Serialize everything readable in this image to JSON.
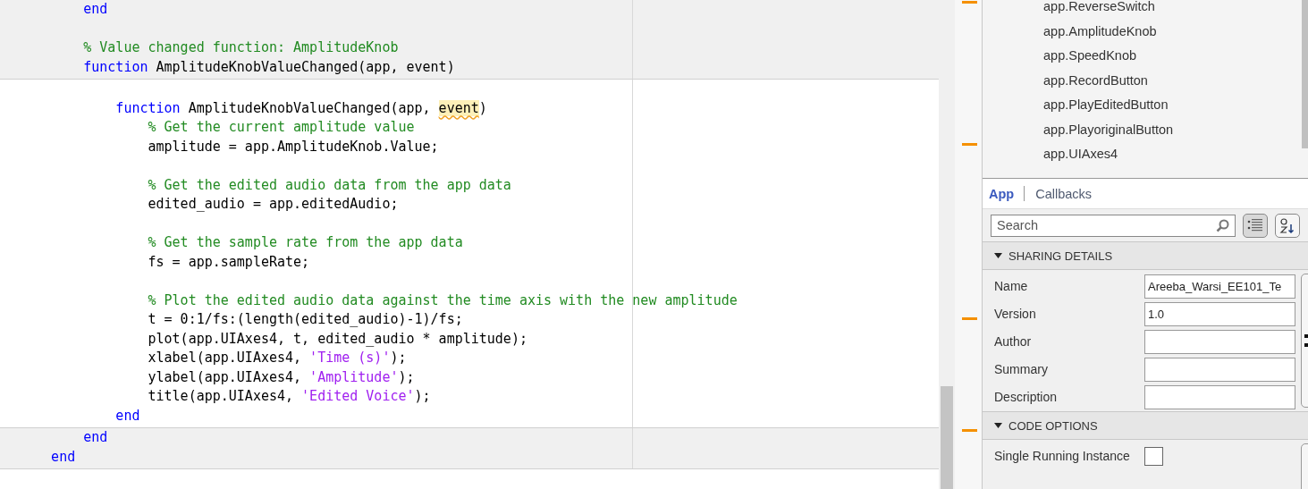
{
  "editor": {
    "blocks": [
      {
        "editable": false,
        "lines": [
          {
            "kind": "code",
            "segments": [
              {
                "kind": "keyword",
                "text": "        end"
              }
            ]
          },
          {
            "kind": "blank"
          },
          {
            "kind": "code",
            "segments": [
              {
                "kind": "comment",
                "text": "        % Value changed function: AmplitudeKnob"
              }
            ]
          },
          {
            "kind": "code",
            "segments": [
              {
                "kind": "keyword",
                "text": "        function"
              },
              {
                "kind": "plain",
                "text": " AmplitudeKnobValueChanged(app, event)"
              }
            ]
          }
        ]
      },
      {
        "editable": true,
        "lines": [
          {
            "kind": "blank"
          },
          {
            "kind": "code",
            "segments": [
              {
                "kind": "keyword",
                "text": "            function"
              },
              {
                "kind": "plain",
                "text": " AmplitudeKnobValueChanged(app, "
              },
              {
                "kind": "warning",
                "text": "event"
              },
              {
                "kind": "plain",
                "text": ")"
              }
            ]
          },
          {
            "kind": "code",
            "segments": [
              {
                "kind": "comment",
                "text": "                % Get the current amplitude value"
              }
            ]
          },
          {
            "kind": "code",
            "segments": [
              {
                "kind": "plain",
                "text": "                amplitude = app.AmplitudeKnob.Value;"
              }
            ]
          },
          {
            "kind": "blank"
          },
          {
            "kind": "code",
            "segments": [
              {
                "kind": "comment",
                "text": "                % Get the edited audio data from the app data"
              }
            ]
          },
          {
            "kind": "code",
            "segments": [
              {
                "kind": "plain",
                "text": "                edited_audio = app.editedAudio;"
              }
            ]
          },
          {
            "kind": "blank"
          },
          {
            "kind": "code",
            "segments": [
              {
                "kind": "comment",
                "text": "                % Get the sample rate from the app data"
              }
            ]
          },
          {
            "kind": "code",
            "segments": [
              {
                "kind": "plain",
                "text": "                fs = app.sampleRate;"
              }
            ]
          },
          {
            "kind": "blank"
          },
          {
            "kind": "code",
            "segments": [
              {
                "kind": "comment",
                "text": "                % Plot the edited audio data against the time axis with the new amplitude"
              }
            ]
          },
          {
            "kind": "code",
            "segments": [
              {
                "kind": "plain",
                "text": "                t = 0:1/fs:(length(edited_audio)-1)/fs;"
              }
            ]
          },
          {
            "kind": "code",
            "segments": [
              {
                "kind": "plain",
                "text": "                plot(app.UIAxes4, t, edited_audio * amplitude);"
              }
            ]
          },
          {
            "kind": "code",
            "segments": [
              {
                "kind": "plain",
                "text": "                xlabel(app.UIAxes4, "
              },
              {
                "kind": "string",
                "text": "'Time (s)'"
              },
              {
                "kind": "plain",
                "text": ");"
              }
            ]
          },
          {
            "kind": "code",
            "segments": [
              {
                "kind": "plain",
                "text": "                ylabel(app.UIAxes4, "
              },
              {
                "kind": "string",
                "text": "'Amplitude'"
              },
              {
                "kind": "plain",
                "text": ");"
              }
            ]
          },
          {
            "kind": "code",
            "segments": [
              {
                "kind": "plain",
                "text": "                title(app.UIAxes4, "
              },
              {
                "kind": "string",
                "text": "'Edited Voice'"
              },
              {
                "kind": "plain",
                "text": ");"
              }
            ]
          },
          {
            "kind": "code",
            "segments": [
              {
                "kind": "keyword",
                "text": "            end"
              }
            ]
          }
        ]
      },
      {
        "editable": false,
        "lines": [
          {
            "kind": "code",
            "segments": [
              {
                "kind": "keyword",
                "text": "        end"
              }
            ]
          },
          {
            "kind": "code",
            "segments": [
              {
                "kind": "keyword",
                "text": "    end"
              }
            ]
          }
        ]
      }
    ]
  },
  "component_browser": {
    "items": [
      "app.ReverseSwitch",
      "app.AmplitudeKnob",
      "app.SpeedKnob",
      "app.RecordButton",
      "app.PlayEditedButton",
      "app.PlayoriginalButton",
      "app.UIAxes4"
    ]
  },
  "inspector": {
    "tabs": [
      {
        "label": "App",
        "selected": true
      },
      {
        "label": "Callbacks",
        "selected": false
      }
    ],
    "search": {
      "placeholder": "Search"
    },
    "sections": [
      {
        "title": "SHARING DETAILS",
        "expanded": true,
        "rows": [
          {
            "kind": "text",
            "label": "Name",
            "value": "Areeba_Warsi_EE101_Te"
          },
          {
            "kind": "text",
            "label": "Version",
            "value": "1.0"
          },
          {
            "kind": "text",
            "label": "Author"
          },
          {
            "kind": "text",
            "label": "Summary"
          },
          {
            "kind": "text",
            "label": "Description"
          }
        ]
      },
      {
        "title": "CODE OPTIONS",
        "expanded": true,
        "rows": [
          {
            "kind": "checkbox",
            "label": "Single Running Instance",
            "checked": false
          }
        ]
      }
    ]
  }
}
